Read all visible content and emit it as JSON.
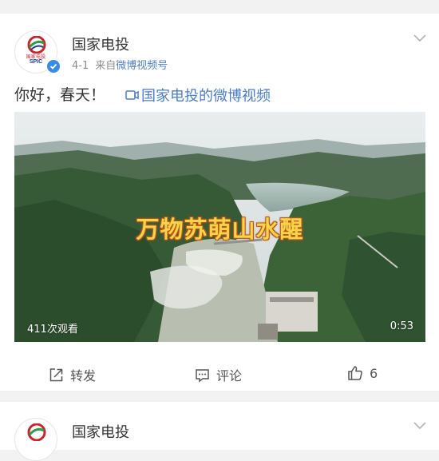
{
  "post": {
    "author": "国家电投",
    "logo_cn": "国家电投",
    "logo_en": "SPIC",
    "time": "4-1",
    "source": "来自",
    "source_link": "微博视频号",
    "text": "你好，春天！",
    "video_link": "国家电投的微博视频",
    "video": {
      "overlay_title": "万物苏萌山水醒",
      "views": "411次观看",
      "duration": "0:53"
    },
    "actions": {
      "repost": "转发",
      "comment": "评论",
      "like_count": "6"
    }
  },
  "next_post": {
    "author": "国家电投"
  },
  "colors": {
    "link_blue": "#4d7ec3",
    "verified_blue": "#3a8be3",
    "brand_red": "#c8262f",
    "overlay_yellow": "#f5d34a"
  },
  "icons": [
    "chevron-down-icon",
    "verified-icon",
    "video-link-icon",
    "repost-icon",
    "comment-icon",
    "like-icon"
  ]
}
